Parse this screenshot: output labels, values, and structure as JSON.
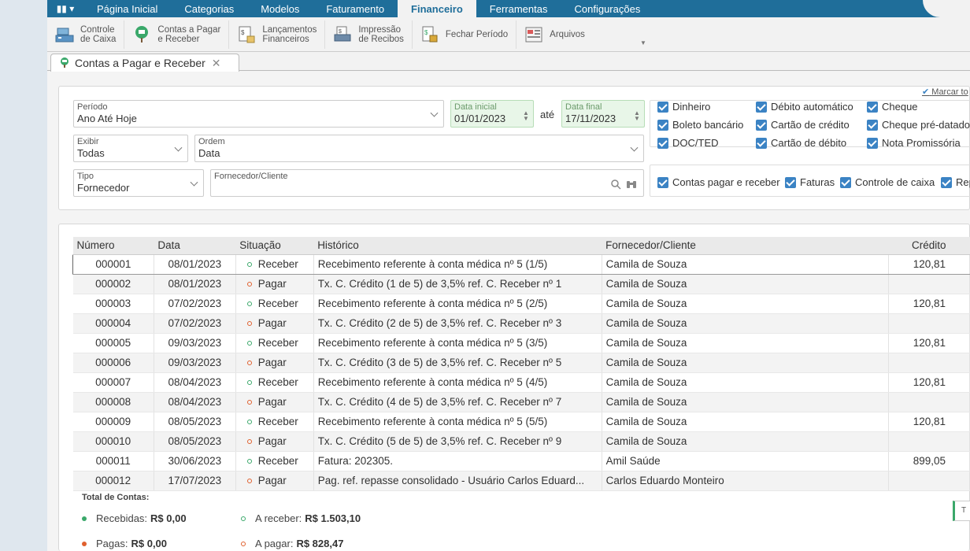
{
  "menu": {
    "items": [
      "Página Inicial",
      "Categorias",
      "Modelos",
      "Faturamento",
      "Financeiro",
      "Ferramentas",
      "Configurações"
    ],
    "active": "Financeiro"
  },
  "ribbon": {
    "controle_caixa": "Controle\nde Caixa",
    "contas": "Contas a Pagar\ne Receber",
    "lancamentos": "Lançamentos\nFinanceiros",
    "impressao": "Impressão\nde Recibos",
    "fechar": "Fechar Período",
    "arquivos": "Arquivos"
  },
  "tab": {
    "label": "Contas a Pagar e Receber"
  },
  "filters": {
    "periodo_caption": "Período",
    "periodo_value": "Ano Até Hoje",
    "data_inicial_caption": "Data inicial",
    "data_inicial_value": "01/01/2023",
    "ate": "até",
    "data_final_caption": "Data final",
    "data_final_value": "17/11/2023",
    "exibir_caption": "Exibir",
    "exibir_value": "Todas",
    "ordem_caption": "Ordem",
    "ordem_value": "Data",
    "tipo_caption": "Tipo",
    "tipo_value": "Fornecedor",
    "fornecedor_caption": "Fornecedor/Cliente",
    "fornecedor_value": ""
  },
  "marcar": "Marcar to",
  "payment_types": [
    "Dinheiro",
    "Débito automático",
    "Cheque",
    "Boleto bancário",
    "Cartão de crédito",
    "Cheque pré-datado",
    "DOC/TED",
    "Cartão de débito",
    "Nota Promissória"
  ],
  "sources": [
    "Contas pagar e receber",
    "Faturas",
    "Controle de caixa",
    "Rep"
  ],
  "table": {
    "headers": [
      "Número",
      "Data",
      "Situação",
      "Histórico",
      "Fornecedor/Cliente",
      "Crédito"
    ],
    "rows": [
      {
        "numero": "000001",
        "data": "08/01/2023",
        "situacao": "Receber",
        "historico": "Recebimento referente à conta médica nº 5 (1/5)",
        "fornecedor": "Camila de Souza",
        "credito": "120,81"
      },
      {
        "numero": "000002",
        "data": "08/01/2023",
        "situacao": "Pagar",
        "historico": "Tx. C. Crédito (1 de 5) de 3,5% ref. C. Receber nº 1",
        "fornecedor": "Camila de Souza",
        "credito": ""
      },
      {
        "numero": "000003",
        "data": "07/02/2023",
        "situacao": "Receber",
        "historico": "Recebimento referente à conta médica nº 5 (2/5)",
        "fornecedor": "Camila de Souza",
        "credito": "120,81"
      },
      {
        "numero": "000004",
        "data": "07/02/2023",
        "situacao": "Pagar",
        "historico": "Tx. C. Crédito (2 de 5) de 3,5% ref. C. Receber nº 3",
        "fornecedor": "Camila de Souza",
        "credito": ""
      },
      {
        "numero": "000005",
        "data": "09/03/2023",
        "situacao": "Receber",
        "historico": "Recebimento referente à conta médica nº 5 (3/5)",
        "fornecedor": "Camila de Souza",
        "credito": "120,81"
      },
      {
        "numero": "000006",
        "data": "09/03/2023",
        "situacao": "Pagar",
        "historico": "Tx. C. Crédito (3 de 5) de 3,5% ref. C. Receber nº 5",
        "fornecedor": "Camila de Souza",
        "credito": ""
      },
      {
        "numero": "000007",
        "data": "08/04/2023",
        "situacao": "Receber",
        "historico": "Recebimento referente à conta médica nº 5 (4/5)",
        "fornecedor": "Camila de Souza",
        "credito": "120,81"
      },
      {
        "numero": "000008",
        "data": "08/04/2023",
        "situacao": "Pagar",
        "historico": "Tx. C. Crédito (4 de 5) de 3,5% ref. C. Receber nº 7",
        "fornecedor": "Camila de Souza",
        "credito": ""
      },
      {
        "numero": "000009",
        "data": "08/05/2023",
        "situacao": "Receber",
        "historico": "Recebimento referente à conta médica nº 5 (5/5)",
        "fornecedor": "Camila de Souza",
        "credito": "120,81"
      },
      {
        "numero": "000010",
        "data": "08/05/2023",
        "situacao": "Pagar",
        "historico": "Tx. C. Crédito (5 de 5) de 3,5% ref. C. Receber nº 9",
        "fornecedor": "Camila de Souza",
        "credito": ""
      },
      {
        "numero": "000011",
        "data": "30/06/2023",
        "situacao": "Receber",
        "historico": "Fatura: 202305.",
        "fornecedor": "Amil Saúde",
        "credito": "899,05"
      },
      {
        "numero": "000012",
        "data": "17/07/2023",
        "situacao": "Pagar",
        "historico": "Pag. ref. repasse consolidado - Usuário Carlos Eduard...",
        "fornecedor": "Carlos Eduardo Monteiro",
        "credito": ""
      }
    ]
  },
  "totals": {
    "title": "Total de Contas:",
    "recebidas_label": "Recebidas:",
    "recebidas_value": "R$ 0,00",
    "a_receber_label": "A receber:",
    "a_receber_value": "R$ 1.503,10",
    "pagas_label": "Pagas:",
    "pagas_value": "R$ 0,00",
    "a_pagar_label": "A pagar:",
    "a_pagar_value": "R$ 828,47",
    "right_stub": "T"
  },
  "colors": {
    "menubar": "#1f6e9a",
    "checkbox": "#3b83c4",
    "receber": "#3aa86a",
    "pagar": "#e0602e"
  }
}
